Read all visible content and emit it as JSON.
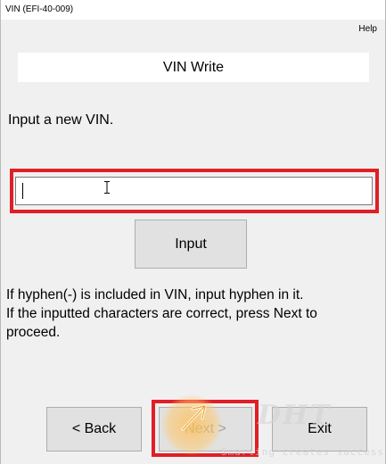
{
  "window": {
    "title": "VIN (EFI-40-009)"
  },
  "menu": {
    "help": "Help"
  },
  "header": {
    "title": "VIN Write"
  },
  "form": {
    "prompt": "Input a new VIN.",
    "vin_value": "",
    "input_button": "Input"
  },
  "info": {
    "line1": "If hyphen(-) is included in VIN, input hyphen in it.",
    "line2": "If the inputted characters are correct, press Next to",
    "line3": "proceed."
  },
  "footer": {
    "back_label": "< Back",
    "next_label": "Next >",
    "next_enabled": false,
    "exit_label": "Exit"
  },
  "watermark": {
    "logo": "DHT",
    "tagline": "Smarting creates success"
  },
  "colors": {
    "highlight": "#e01f26",
    "background": "#f0f0f0",
    "button": "#e1e1e1",
    "cursor_glow": "#ffbe50"
  },
  "icons": {
    "text_cursor": "ibeam-icon",
    "mouse_cursor": "arrow-cursor-icon"
  }
}
